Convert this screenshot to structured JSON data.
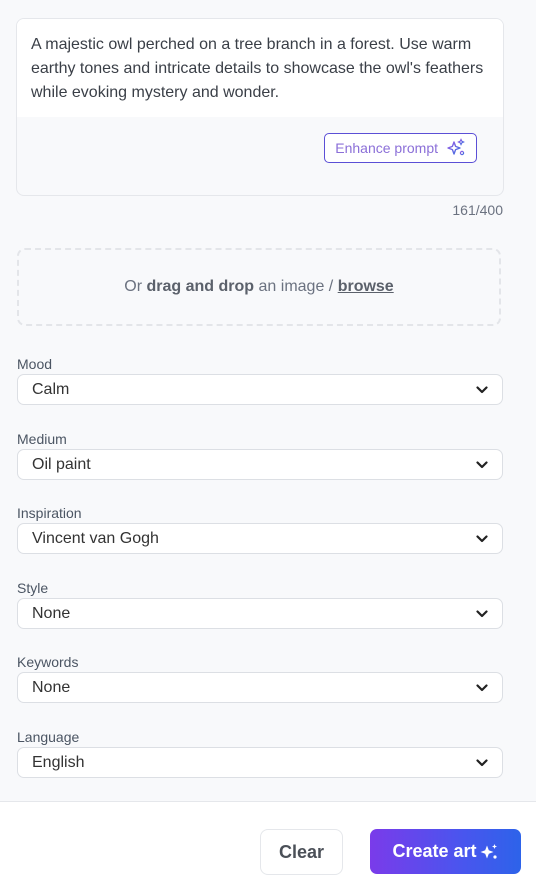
{
  "prompt": {
    "text": "A majestic owl perched on a tree branch in a forest. Use warm earthy tones and intricate details to showcase the owl's feathers while evoking mystery and wonder.",
    "enhance_label": "Enhance prompt",
    "enhance_icon": "sparkles-icon",
    "counter": "161/400"
  },
  "dropzone": {
    "prefix": "Or ",
    "bold": "drag and drop",
    "middle": " an image / ",
    "link": "browse"
  },
  "fields": [
    {
      "label": "Mood",
      "value": "Calm"
    },
    {
      "label": "Medium",
      "value": "Oil paint"
    },
    {
      "label": "Inspiration",
      "value": "Vincent van Gogh"
    },
    {
      "label": "Style",
      "value": "None"
    },
    {
      "label": "Keywords",
      "value": "None"
    },
    {
      "label": "Language",
      "value": "English"
    }
  ],
  "footer": {
    "clear_label": "Clear",
    "create_label": "Create art",
    "create_icon": "sparkles-icon"
  },
  "colors": {
    "accent_start": "#7a3bea",
    "accent_end": "#2d63ea",
    "enhance_text": "#8b6fd8"
  }
}
